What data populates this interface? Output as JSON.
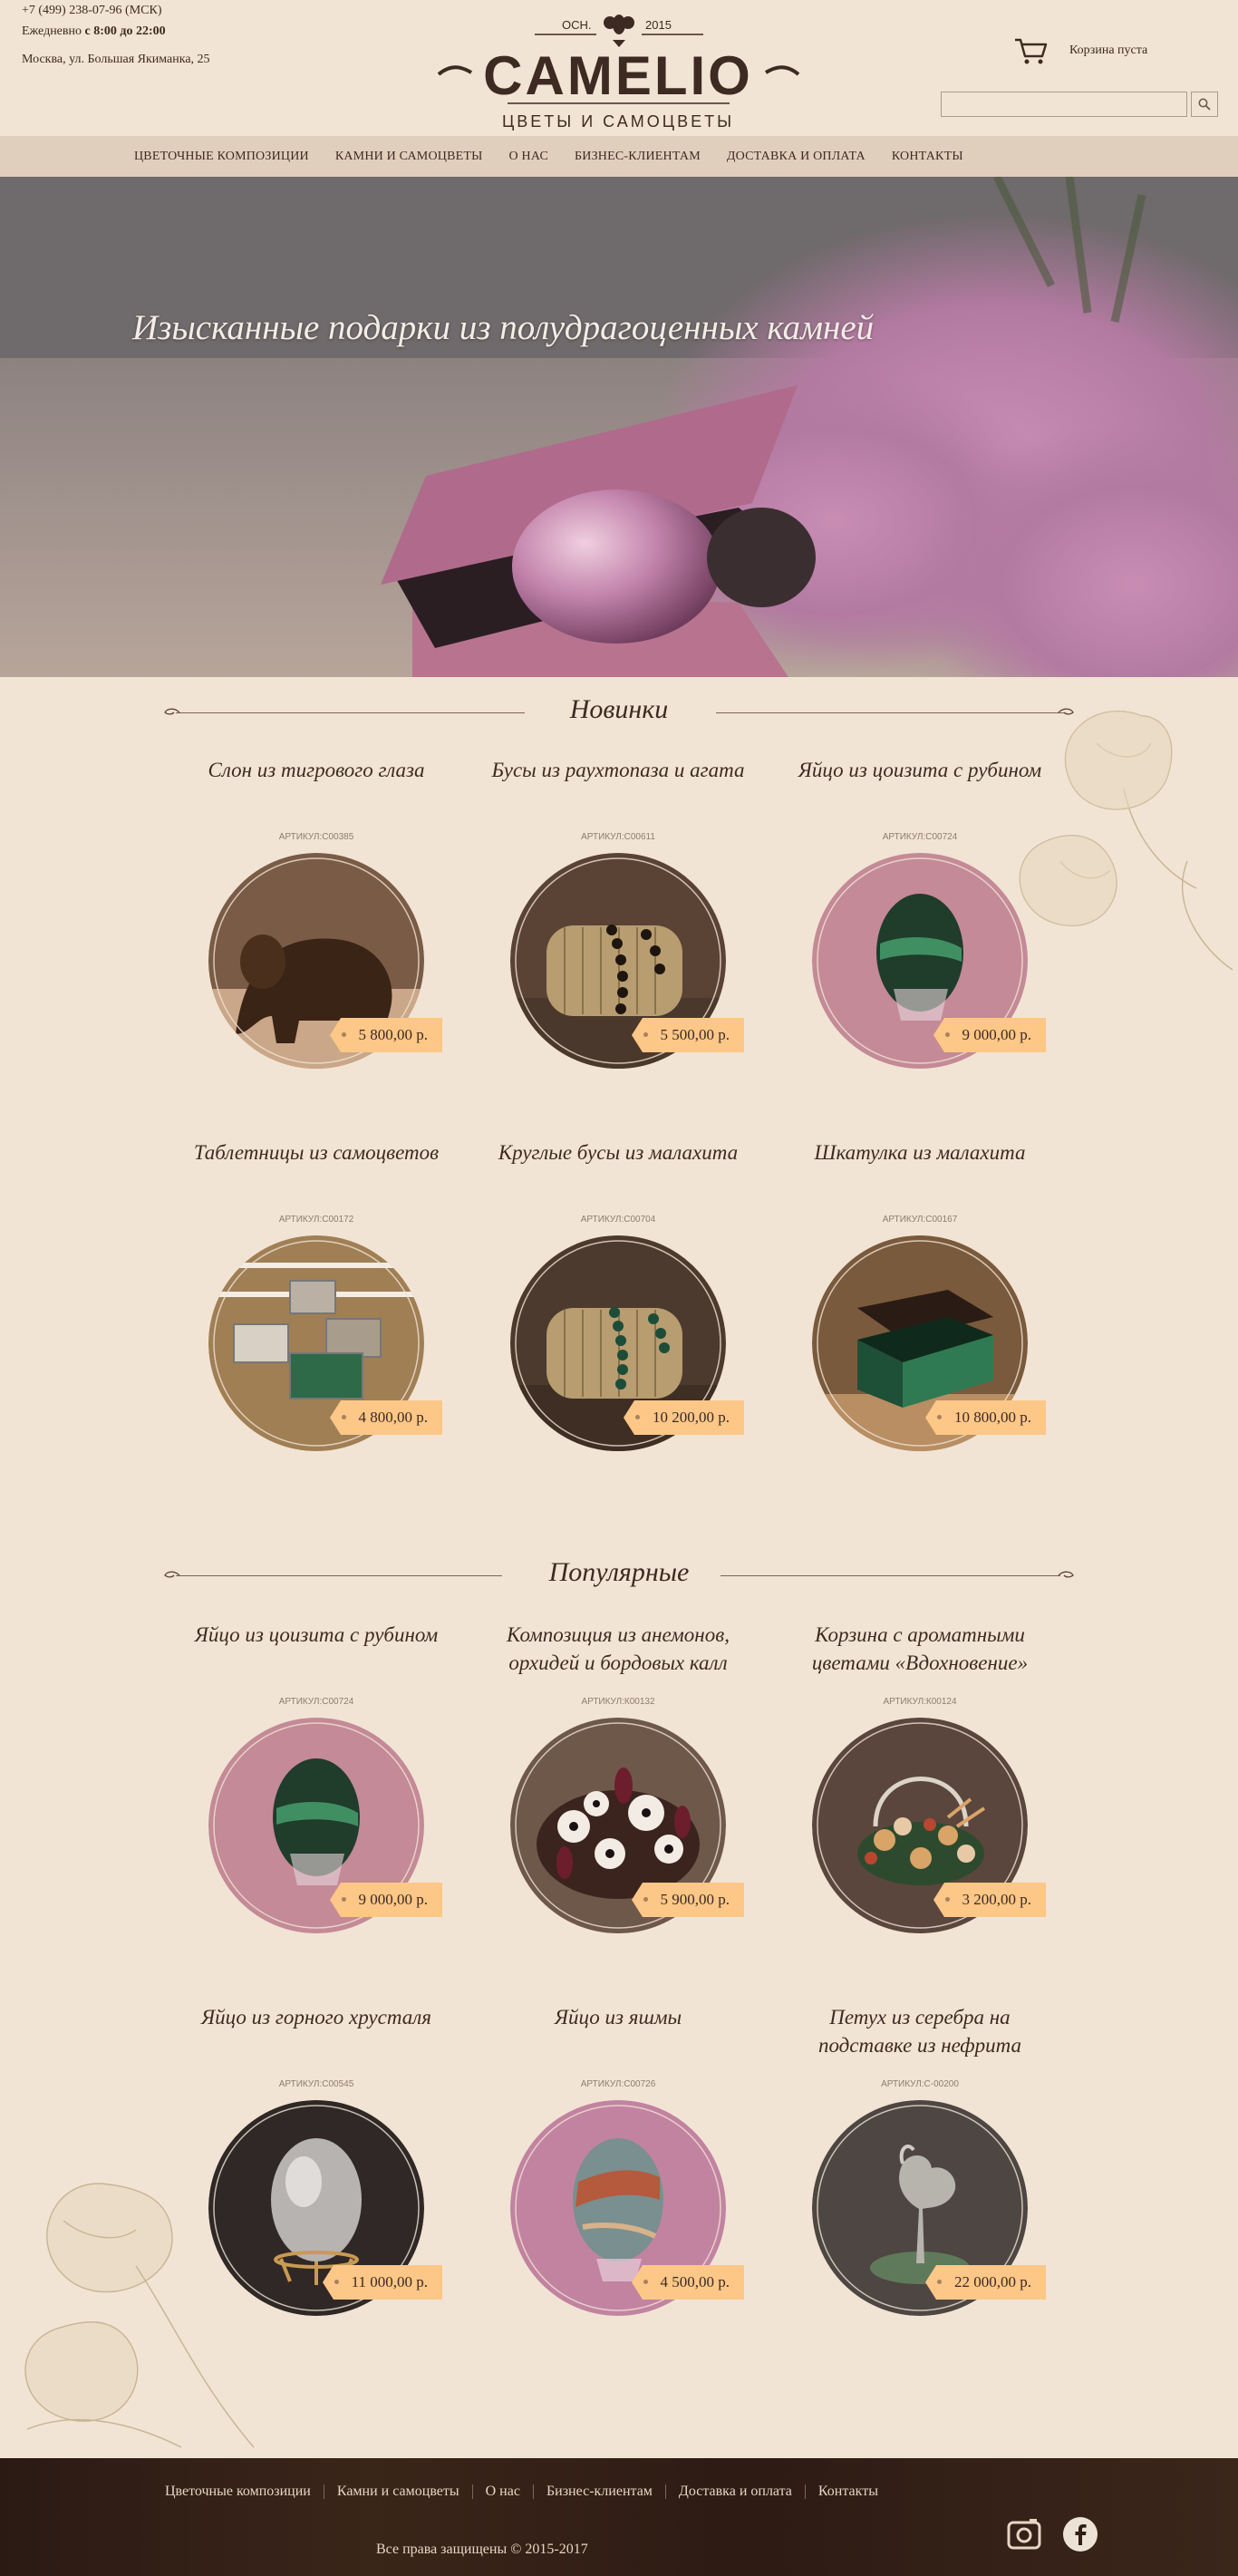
{
  "header": {
    "phone": "+7 (499) 238-07-96 (МСК)",
    "hours_prefix": "Ежедневно",
    "hours": "с 8:00 до 22:00",
    "address": "Москва, ул. Большая Якиманка, 25",
    "logo": {
      "est": "ОСН.",
      "year": "2015",
      "name": "CAMELIO",
      "tagline": "ЦВЕТЫ И САМОЦВЕТЫ"
    },
    "cart_label": "Корзина пуста",
    "search_placeholder": ""
  },
  "nav": [
    "ЦВЕТОЧНЫЕ КОМПОЗИЦИИ",
    "КАМНИ И САМОЦВЕТЫ",
    "О НАС",
    "БИЗНЕС-КЛИЕНТАМ",
    "ДОСТАВКА И ОПЛАТА",
    "КОНТАКТЫ"
  ],
  "hero": {
    "title": "Изысканные подарки из полудрагоценных камней"
  },
  "sections": [
    {
      "title": "Новинки",
      "products": [
        {
          "name": "Слон из тигрового глаза",
          "sku": "АРТИКУЛ:С00385",
          "price": "5 800,00 р."
        },
        {
          "name": "Бусы из раухтопаза и агата",
          "sku": "АРТИКУЛ:С00611",
          "price": "5 500,00 р."
        },
        {
          "name": "Яйцо из цоизита с рубином",
          "sku": "АРТИКУЛ:С00724",
          "price": "9 000,00 р."
        },
        {
          "name": "Таблетницы из самоцветов",
          "sku": "АРТИКУЛ:С00172",
          "price": "4 800,00 р."
        },
        {
          "name": "Круглые бусы из малахита",
          "sku": "АРТИКУЛ:С00704",
          "price": "10 200,00 р."
        },
        {
          "name": "Шкатулка из малахита",
          "sku": "АРТИКУЛ:С00167",
          "price": "10 800,00 р."
        }
      ]
    },
    {
      "title": "Популярные",
      "products": [
        {
          "name": "Яйцо из цоизита с рубином",
          "sku": "АРТИКУЛ:С00724",
          "price": "9 000,00 р."
        },
        {
          "name": "Композиция из анемонов, орхидей и бордовых калл",
          "sku": "АРТИКУЛ:К00132",
          "price": "5 900,00 р."
        },
        {
          "name": "Корзина с ароматными цветами «Вдохновение»",
          "sku": "АРТИКУЛ:К00124",
          "price": "3 200,00 р."
        },
        {
          "name": "Яйцо из горного хрусталя",
          "sku": "АРТИКУЛ:С00545",
          "price": "11 000,00 р."
        },
        {
          "name": "Яйцо из яшмы",
          "sku": "АРТИКУЛ:С00726",
          "price": "4 500,00 р."
        },
        {
          "name": "Петух из серебра на подставке из нефрита",
          "sku": "АРТИКУЛ:С-00200",
          "price": "22 000,00 р."
        }
      ]
    }
  ],
  "footer": {
    "nav": [
      "Цветочные композиции",
      "Камни и самоцветы",
      "О нас",
      "Бизнес-клиентам",
      "Доставка и оплата",
      "Контакты"
    ],
    "copyright": "Все права защищены © 2015-2017",
    "social": [
      "instagram-icon",
      "facebook-icon"
    ]
  },
  "colors": {
    "background": "#f1e4d4",
    "nav_bar": "#e1cfbd",
    "price_tag": "#fcc787",
    "text": "#3d2a22",
    "footer": "#2f1d16"
  }
}
